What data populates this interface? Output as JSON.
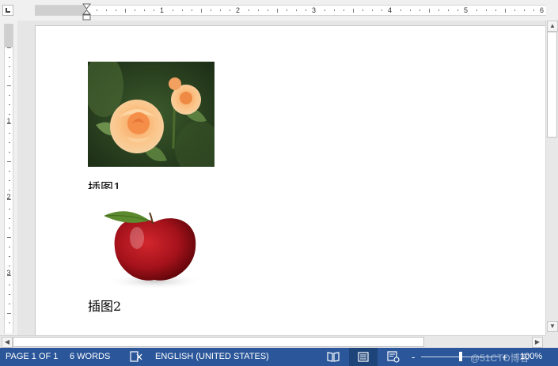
{
  "ruler": {
    "top_numbers": [
      "1",
      "2",
      "3",
      "4",
      "5",
      "6"
    ],
    "left_numbers": [
      "1",
      "2",
      "3"
    ]
  },
  "document": {
    "figures": [
      {
        "image": "rose-flower-photo",
        "caption": "插图1"
      },
      {
        "image": "red-apple-photo",
        "caption": "插图2"
      }
    ]
  },
  "status_bar": {
    "page": "PAGE 1 OF 1",
    "words": "6 WORDS",
    "proofing_icon": "proofing-icon",
    "language": "ENGLISH (UNITED STATES)",
    "zoom_out": "-",
    "zoom_in": "+",
    "zoom": "100%",
    "views": [
      "read-mode-icon",
      "print-layout-icon",
      "web-layout-icon"
    ],
    "active_view": "print-layout-icon",
    "zoom_level_fraction": 0.5
  },
  "watermark": "@51CTO博客",
  "colors": {
    "status_bar": "#2b579a",
    "page": "#ffffff",
    "background": "#e6e6e6"
  }
}
